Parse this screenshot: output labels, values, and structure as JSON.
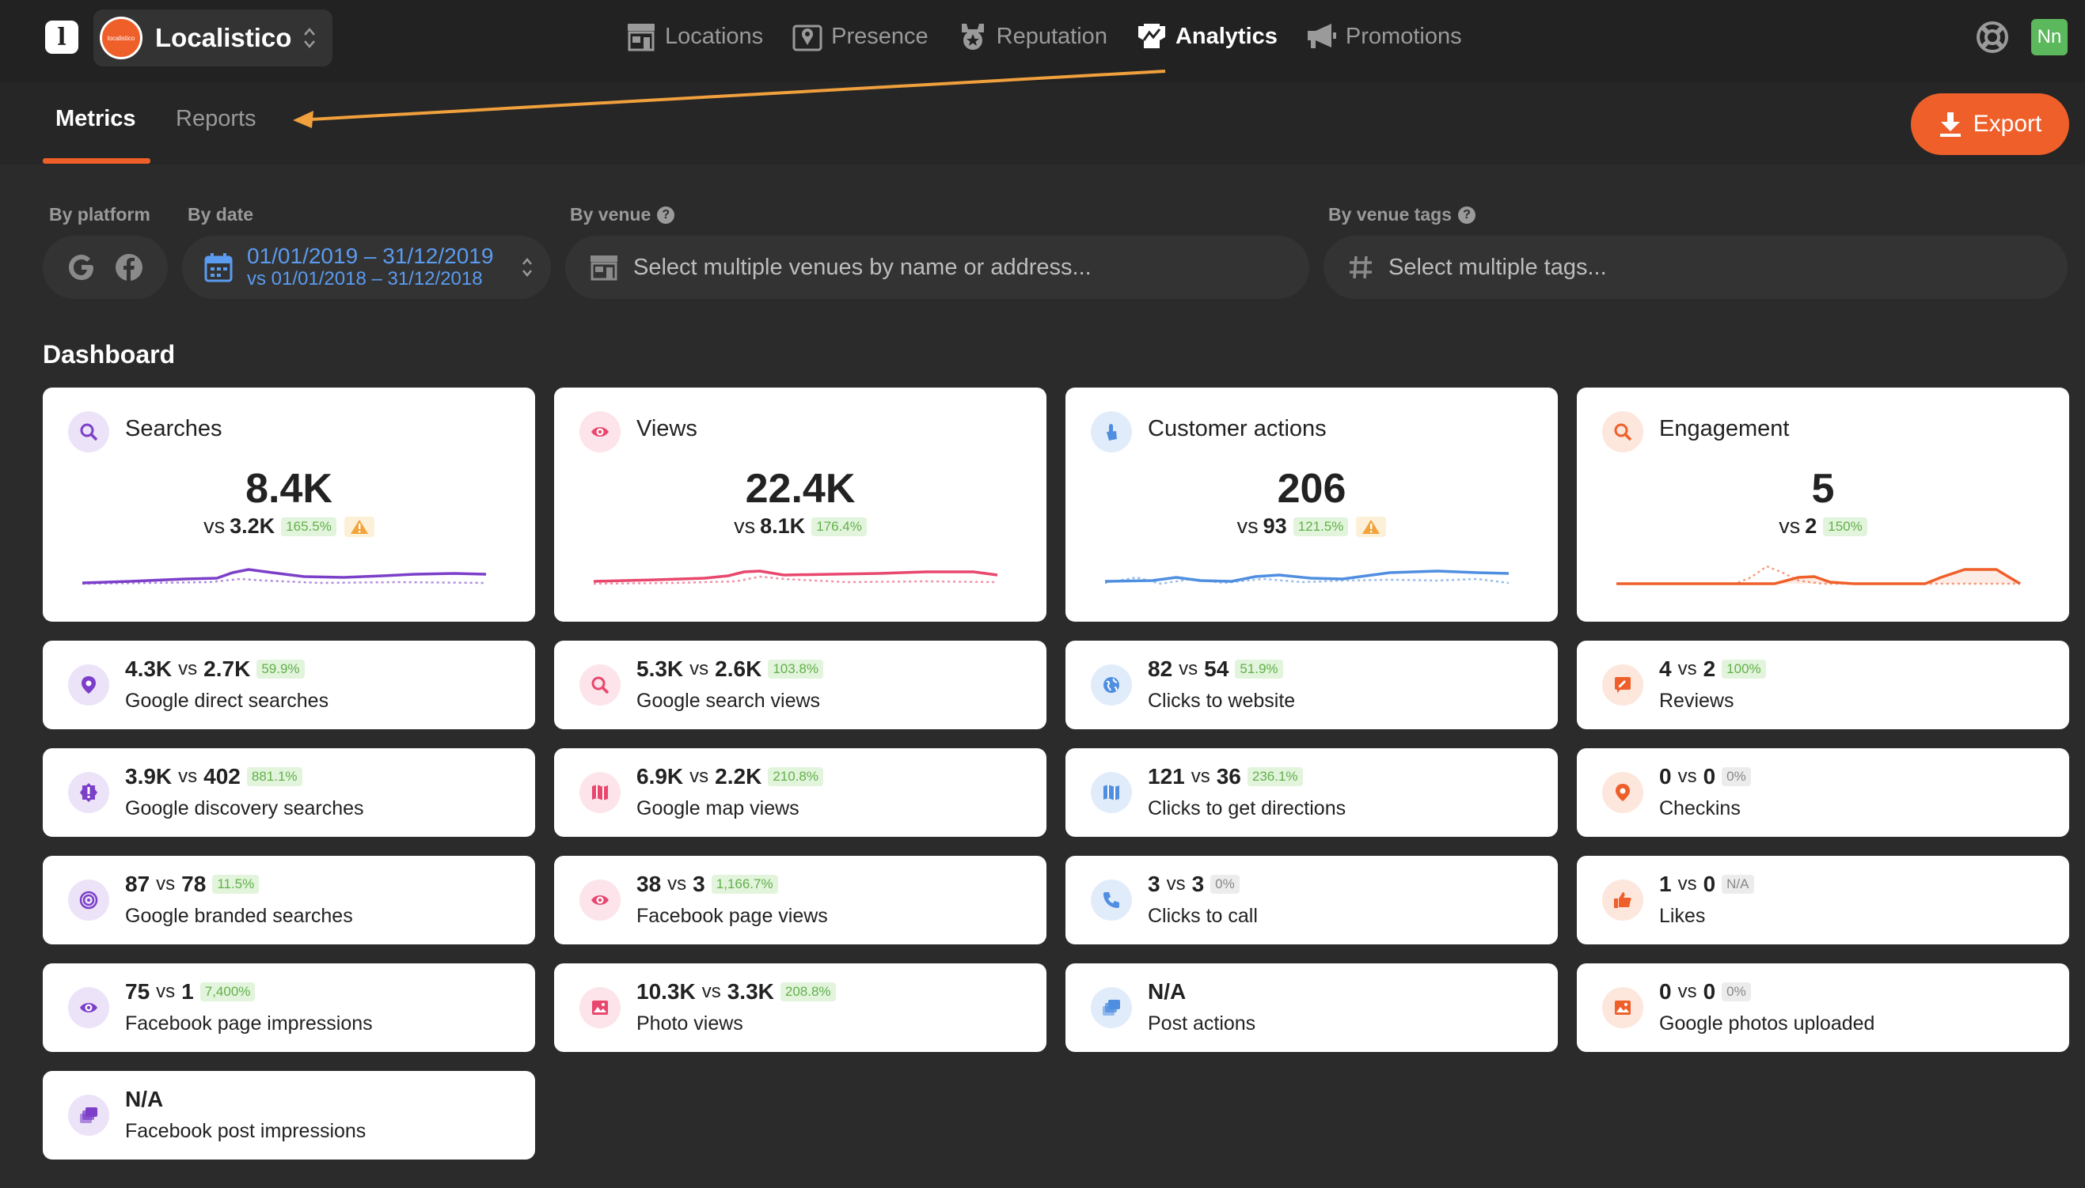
{
  "app": {
    "org_name": "Localistico",
    "org_avatar_text": "localistico",
    "user_initials": "Nn"
  },
  "nav": {
    "items": [
      {
        "label": "Locations",
        "icon": "store-icon",
        "active": false
      },
      {
        "label": "Presence",
        "icon": "pin-icon",
        "active": false
      },
      {
        "label": "Reputation",
        "icon": "badge-icon",
        "active": false
      },
      {
        "label": "Analytics",
        "icon": "analytics-icon",
        "active": true
      },
      {
        "label": "Promotions",
        "icon": "megaphone-icon",
        "active": false
      }
    ]
  },
  "subnav": {
    "tabs": [
      {
        "label": "Metrics",
        "active": true
      },
      {
        "label": "Reports",
        "active": false
      }
    ],
    "export_label": "Export"
  },
  "filters": {
    "platform_label": "By platform",
    "date_label": "By date",
    "date_range": "01/01/2019 – 31/12/2019",
    "date_compare": "vs 01/01/2018 – 31/12/2018",
    "venue_label": "By venue",
    "venue_placeholder": "Select multiple venues by name or address...",
    "tags_label": "By venue tags",
    "tags_placeholder": "Select multiple tags..."
  },
  "dashboard": {
    "title": "Dashboard",
    "summary": [
      {
        "title": "Searches",
        "value": "8.4K",
        "vs": "vs",
        "prev": "3.2K",
        "pct": "165.5%",
        "warning": true,
        "color": "#7c3fc9",
        "bg": "#ece3f8"
      },
      {
        "title": "Views",
        "value": "22.4K",
        "vs": "vs",
        "prev": "8.1K",
        "pct": "176.4%",
        "warning": false,
        "color": "#e8476e",
        "bg": "#fce4ea"
      },
      {
        "title": "Customer actions",
        "value": "206",
        "vs": "vs",
        "prev": "93",
        "pct": "121.5%",
        "warning": true,
        "color": "#4f8ee0",
        "bg": "#e1ecfb"
      },
      {
        "title": "Engagement",
        "value": "5",
        "vs": "vs",
        "prev": "2",
        "pct": "150%",
        "warning": false,
        "color": "#ef5f2a",
        "bg": "#fde6dc"
      }
    ],
    "metrics": [
      [
        {
          "cur": "4.3K",
          "prev": "2.7K",
          "pct": "59.9%",
          "label": "Google direct searches",
          "icon": "location-pin-icon"
        },
        {
          "cur": "3.9K",
          "prev": "402",
          "pct": "881.1%",
          "label": "Google discovery searches",
          "icon": "discovery-icon"
        },
        {
          "cur": "87",
          "prev": "78",
          "pct": "11.5%",
          "label": "Google branded searches",
          "icon": "target-icon"
        },
        {
          "cur": "75",
          "prev": "1",
          "pct": "7,400%",
          "label": "Facebook page impressions",
          "icon": "eye-icon"
        },
        {
          "cur": "N/A",
          "prev": "",
          "pct": "",
          "label": "Facebook post impressions",
          "icon": "posts-icon"
        }
      ],
      [
        {
          "cur": "5.3K",
          "prev": "2.6K",
          "pct": "103.8%",
          "label": "Google search views",
          "icon": "search-icon"
        },
        {
          "cur": "6.9K",
          "prev": "2.2K",
          "pct": "210.8%",
          "label": "Google map views",
          "icon": "map-icon"
        },
        {
          "cur": "38",
          "prev": "3",
          "pct": "1,166.7%",
          "label": "Facebook page views",
          "icon": "eye-icon"
        },
        {
          "cur": "10.3K",
          "prev": "3.3K",
          "pct": "208.8%",
          "label": "Photo views",
          "icon": "photo-icon"
        }
      ],
      [
        {
          "cur": "82",
          "prev": "54",
          "pct": "51.9%",
          "label": "Clicks to website",
          "icon": "globe-icon"
        },
        {
          "cur": "121",
          "prev": "36",
          "pct": "236.1%",
          "label": "Clicks to get directions",
          "icon": "map-icon"
        },
        {
          "cur": "3",
          "prev": "3",
          "pct": "0%",
          "label": "Clicks to call",
          "icon": "phone-icon"
        },
        {
          "cur": "N/A",
          "prev": "",
          "pct": "",
          "label": "Post actions",
          "icon": "posts-icon"
        }
      ],
      [
        {
          "cur": "4",
          "prev": "2",
          "pct": "100%",
          "label": "Reviews",
          "icon": "review-icon"
        },
        {
          "cur": "0",
          "prev": "0",
          "pct": "0%",
          "label": "Checkins",
          "icon": "location-pin-icon"
        },
        {
          "cur": "1",
          "prev": "0",
          "pct": "N/A",
          "label": "Likes",
          "icon": "thumbs-up-icon"
        },
        {
          "cur": "0",
          "prev": "0",
          "pct": "0%",
          "label": "Google photos uploaded",
          "icon": "photo-icon"
        }
      ]
    ]
  }
}
